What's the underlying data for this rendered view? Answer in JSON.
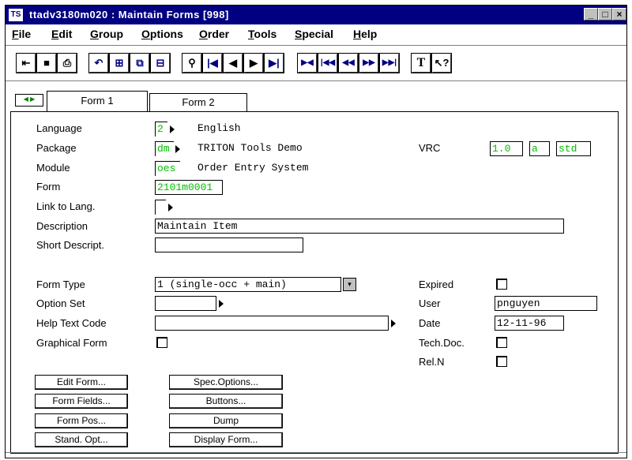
{
  "window": {
    "title": "ttadv3180m020 : Maintain Forms [998]"
  },
  "menu": [
    "File",
    "Edit",
    "Group",
    "Options",
    "Order",
    "Tools",
    "Special",
    "Help"
  ],
  "toolbar_icons": [
    "exit-icon",
    "save-icon",
    "print-icon",
    "undo-icon",
    "duplicate-icon",
    "copy-icon",
    "delete-record-icon",
    "find-icon",
    "first-record-icon",
    "previous-record-icon",
    "next-record-icon",
    "last-record-icon",
    "first-group-icon",
    "first-set-icon",
    "previous-set-icon",
    "next-set-icon",
    "last-set-icon",
    "text-icon",
    "help-pointer-icon"
  ],
  "tabs": {
    "tab1": "Form 1",
    "tab2": "Form 2"
  },
  "form": {
    "language": {
      "label": "Language",
      "code": "2",
      "name": "English"
    },
    "package": {
      "label": "Package",
      "code": "dm",
      "name": "TRITON Tools Demo"
    },
    "vrc": {
      "label": "VRC",
      "version": "1.0",
      "release": "a",
      "customer": "std"
    },
    "module": {
      "label": "Module",
      "code": "oes",
      "name": "Order Entry System"
    },
    "form": {
      "label": "Form",
      "value": "2101m0001"
    },
    "link_to_lang": {
      "label": "Link to Lang."
    },
    "description": {
      "label": "Description",
      "value": "Maintain Item"
    },
    "short_descript": {
      "label": "Short Descript.",
      "value": ""
    },
    "form_type": {
      "label": "Form Type",
      "value": "1 (single-occ + main)"
    },
    "option_set": {
      "label": "Option Set",
      "value": ""
    },
    "help_text_code": {
      "label": "Help Text Code",
      "value": ""
    },
    "graphical_form": {
      "label": "Graphical Form"
    },
    "expired": {
      "label": "Expired"
    },
    "user": {
      "label": "User",
      "value": "pnguyen"
    },
    "date": {
      "label": "Date",
      "value": "12-11-96"
    },
    "tech_doc": {
      "label": "Tech.Doc."
    },
    "rel_n": {
      "label": "Rel.N"
    }
  },
  "buttons": {
    "edit_form": "Edit Form...",
    "spec_options": "Spec.Options...",
    "form_fields": "Form Fields...",
    "buttons": "Buttons...",
    "form_pos": "Form Pos...",
    "dump": "Dump",
    "stand_opt": "Stand. Opt...",
    "display_form": "Display Form..."
  }
}
